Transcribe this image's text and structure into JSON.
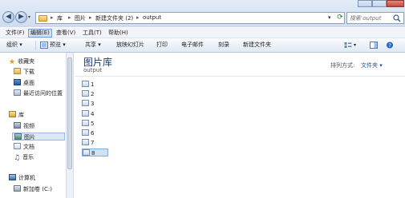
{
  "address": {
    "crumbs": [
      "库",
      "图片",
      "新建文件夹 (2)",
      "output"
    ]
  },
  "search": {
    "placeholder": "搜索 output"
  },
  "menu": [
    "文件(F)",
    "编辑(E)",
    "查看(V)",
    "工具(T)",
    "帮助(H)"
  ],
  "toolbar": {
    "organize": "组织 ▾",
    "preview": "预览 ▾",
    "share": "共享 ▾",
    "slideshow": "放映幻灯片",
    "print": "打印",
    "email": "电子邮件",
    "burn": "刻录",
    "newfolder": "新建文件夹"
  },
  "sidebar": {
    "favorites": "收藏夹",
    "downloads": "下载",
    "desktop": "桌面",
    "recent": "最近访问的位置",
    "libraries": "库",
    "videos": "视频",
    "pictures": "图片",
    "documents": "文档",
    "music": "音乐",
    "computer": "计算机",
    "newvolume": "新加卷 (C:)"
  },
  "content": {
    "title": "图片库",
    "subtitle": "output",
    "arrange_label": "排列方式:",
    "arrange_value": "文件夹 ▾",
    "files": [
      "1",
      "2",
      "3",
      "4",
      "5",
      "6",
      "7",
      "8"
    ]
  },
  "colors": {
    "accent": "#1e3a6e",
    "selection": "#cfe1f7"
  }
}
